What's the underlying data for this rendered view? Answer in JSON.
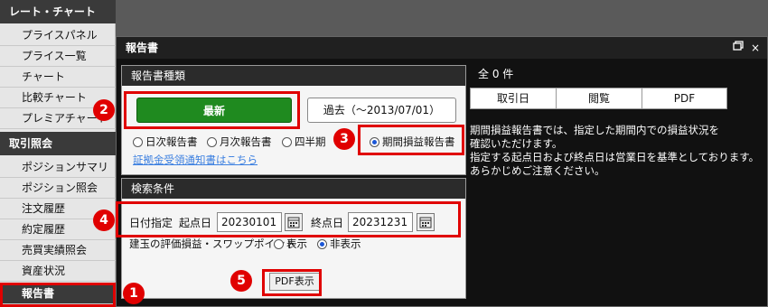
{
  "sidebar": {
    "section1": "レート・チャート",
    "section1_items": [
      "プライスパネル",
      "プライス一覧",
      "チャート",
      "比較チャート",
      "プレミアチャート"
    ],
    "section2": "取引照会",
    "section2_items": [
      "ポジションサマリ",
      "ポジション照会",
      "注文履歴",
      "約定履歴",
      "売買実績照会",
      "資産状況",
      "報告書"
    ]
  },
  "modal": {
    "title": "報告書",
    "restore_icon": "restore-icon",
    "close_label": "×"
  },
  "report_type": {
    "header": "報告書種類",
    "latest_button": "最新",
    "past_button": "過去（～2013/07/01）",
    "radios": [
      "日次報告書",
      "月次報告書",
      "四半期",
      "期間損益報告書"
    ],
    "link": "証拠金受領通知書はこちら"
  },
  "search": {
    "header": "検索条件",
    "date_label": "日付指定",
    "start_label": "起点日",
    "start_value": "20230101",
    "end_label": "終点日",
    "end_value": "20231231",
    "eval_label": "建玉の評価損益・スワップポイント",
    "show_label": "表示",
    "hide_label": "非表示",
    "pdf_button": "PDF表示"
  },
  "results": {
    "count": "全 0 件",
    "columns": [
      "取引日",
      "閲覧",
      "PDF"
    ],
    "note": [
      "期間損益報告書では、指定した期間内での損益状況を",
      "確認いただけます。",
      "指定する起点日および終点日は営業日を基準としております。",
      "あらかじめご注意ください。"
    ]
  },
  "badges": [
    "1",
    "2",
    "3",
    "4",
    "5"
  ],
  "colors": {
    "annotation_red": "#e00000",
    "latest_green": "#1f8a1f",
    "radio_blue": "#1a56d6",
    "link_blue": "#3b7fe0"
  }
}
